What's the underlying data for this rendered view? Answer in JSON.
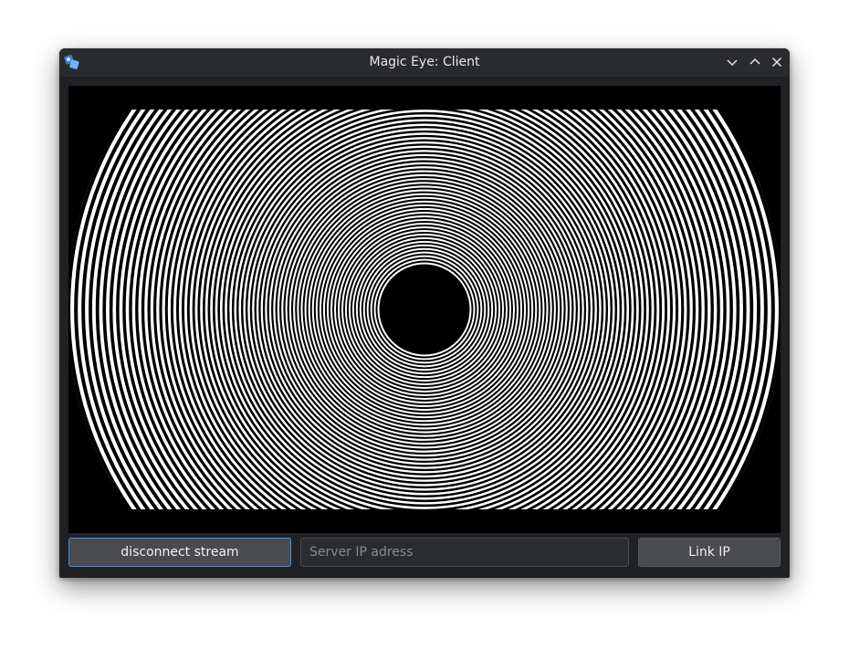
{
  "window": {
    "title": "Magic Eye: Client"
  },
  "titlebar": {
    "app_icon": "app-icon",
    "buttons": [
      {
        "name": "minimize",
        "icon": "chevron-down-icon"
      },
      {
        "name": "maximize",
        "icon": "chevron-up-icon"
      },
      {
        "name": "close",
        "icon": "close-icon"
      }
    ]
  },
  "stream": {
    "pattern": "concentric-rings",
    "description_colors": {
      "background": "#000000",
      "ring": "#ffffff"
    }
  },
  "controls": {
    "disconnect_label": "disconnect stream",
    "server_ip_value": "",
    "server_ip_placeholder": "Server IP adress",
    "link_label": "Link IP"
  },
  "colors": {
    "window_bg": "#202124",
    "titlebar_bg": "#2a2b2e",
    "button_bg": "#4a4b4f",
    "focus_accent": "#3d8ee6"
  }
}
